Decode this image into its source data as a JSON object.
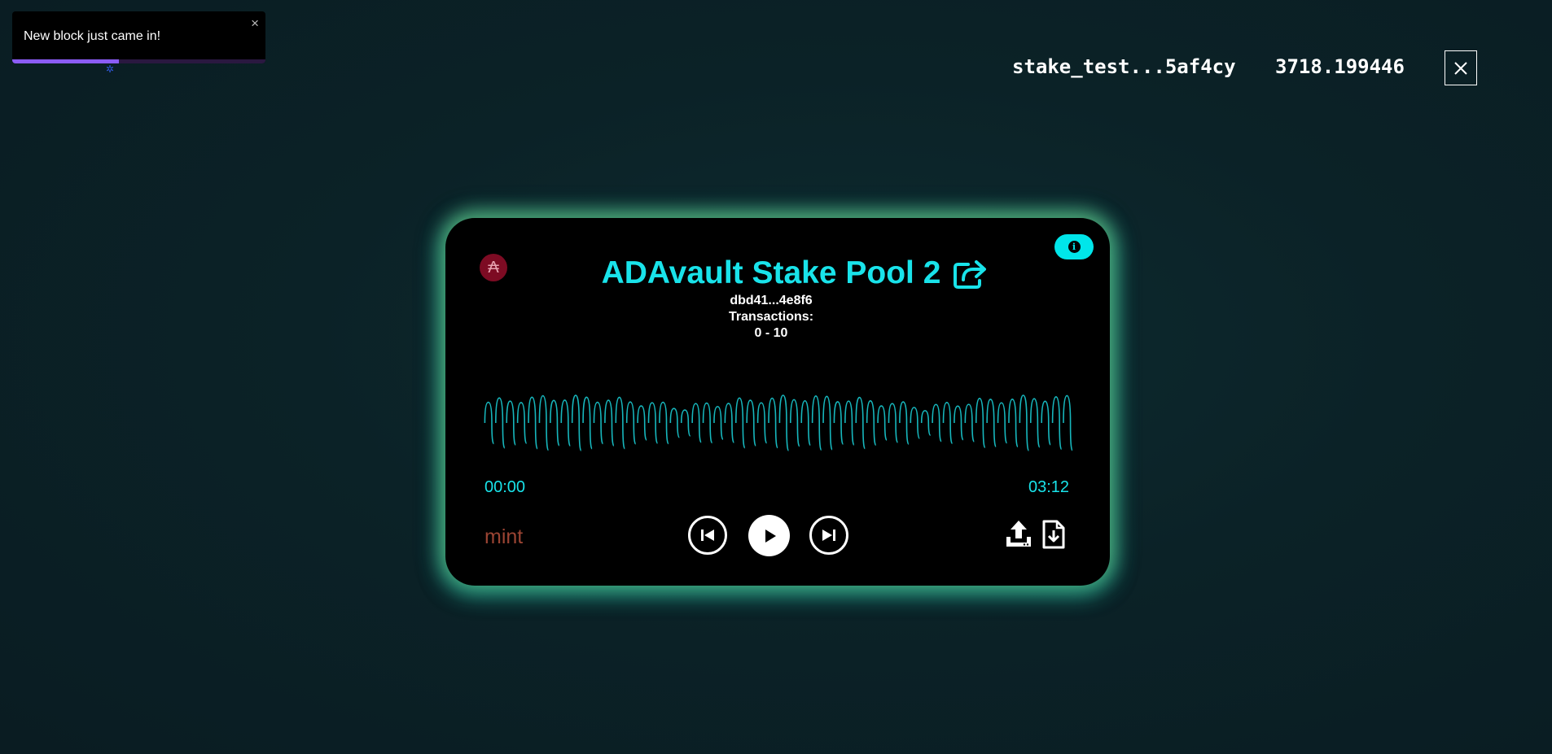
{
  "toast": {
    "message": "New block just came in!",
    "close_glyph": "×",
    "progress": 0.42,
    "progress_color": "#8b5cf6"
  },
  "header": {
    "wallet_address": "stake_test...5af4cy",
    "balance": "3718.199446",
    "close_icon": "close-icon"
  },
  "player": {
    "badge_glyph": "₳",
    "badge_icon": "ada-currency-icon",
    "info_icon": "info-icon",
    "title": "ADAvault Stake Pool 2",
    "share_icon": "share-icon",
    "pool_id": "dbd41...4e8f6",
    "transactions_label": "Transactions:",
    "transactions_range": "0 - 10",
    "time_start": "00:00",
    "time_end": "03:12",
    "mint_label": "mint",
    "controls": {
      "previous_icon": "skip-previous-icon",
      "play_icon": "play-icon",
      "next_icon": "skip-next-icon",
      "upload_icon": "upload-icon",
      "download_icon": "file-download-icon"
    },
    "colors": {
      "accent": "#19e3ea",
      "mint": "#9b4433",
      "badge": "#7d0b23"
    }
  }
}
